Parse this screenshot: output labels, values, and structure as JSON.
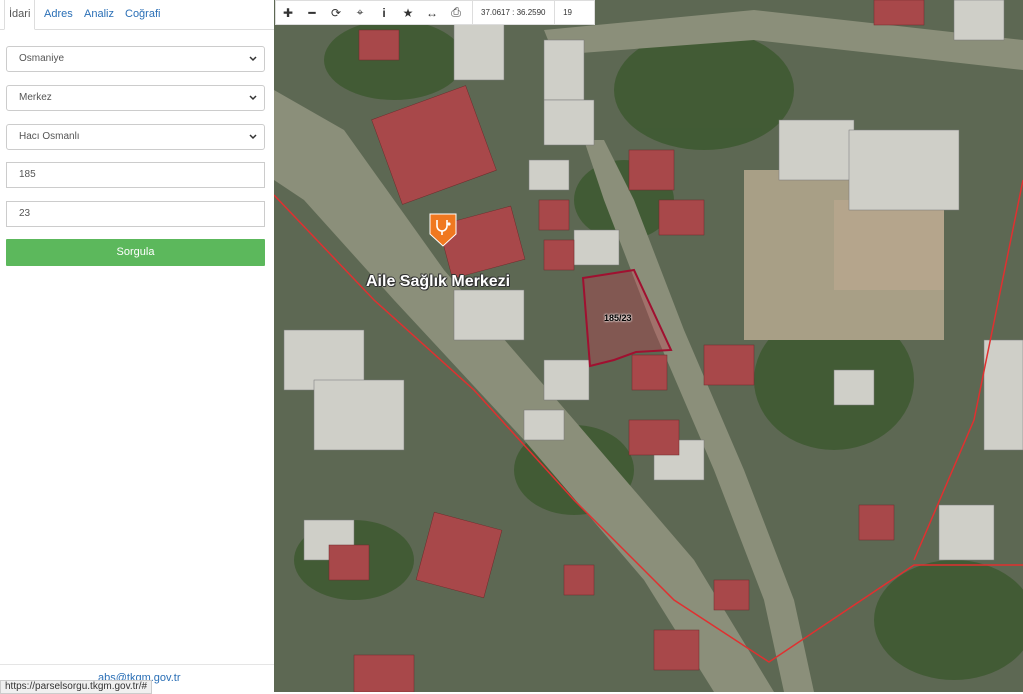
{
  "tabs": [
    "İdari",
    "Adres",
    "Analiz",
    "Coğrafi"
  ],
  "form": {
    "province": "Osmaniye",
    "district": "Merkez",
    "neighborhood": "Hacı Osmanlı",
    "block": "185",
    "parcel": "23",
    "submit": "Sorgula"
  },
  "footer": {
    "email": "abs@tkgm.gov.tr",
    "status_url": "https://parselsorgu.tkgm.gov.tr/#"
  },
  "toolbar": {
    "coordinates": "37.0617 : 36.2590",
    "zoom": "19",
    "icons": [
      "plus-icon",
      "minus-icon",
      "refresh-icon",
      "crosshair-icon",
      "info-icon",
      "star-icon",
      "arrows-icon",
      "print-icon"
    ]
  },
  "map": {
    "poi_label": "Aile Sağlık Merkezi",
    "parcel_label": "185/23",
    "colors": {
      "boundary": "#e03030",
      "parcel": "#a01030",
      "poi": "#f07820",
      "button": "#5cb85c"
    }
  }
}
